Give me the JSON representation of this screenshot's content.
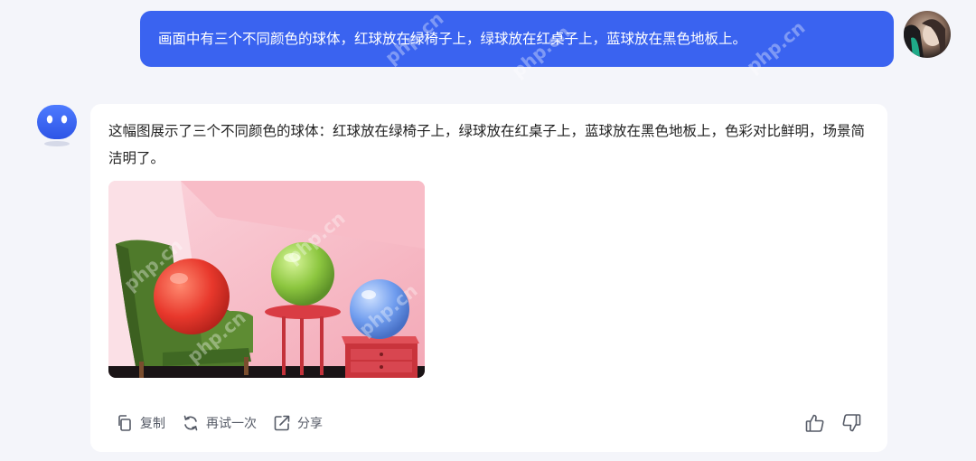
{
  "user_message": {
    "text": "画面中有三个不同颜色的球体，红球放在绿椅子上，绿球放在红桌子上，蓝球放在黑色地板上。",
    "bubble_color": "#3a63f0"
  },
  "bot_message": {
    "text": "这幅图展示了三个不同颜色的球体：红球放在绿椅子上，绿球放在红桌子上，蓝球放在黑色地板上，色彩对比鲜明，场景简洁明了。",
    "image_icon": "generated-image"
  },
  "actions": {
    "copy_label": "复制",
    "retry_label": "再试一次",
    "share_label": "分享"
  },
  "icons": {
    "copy": "copy-icon",
    "retry": "refresh-icon",
    "share": "share-icon",
    "like": "thumbs-up-icon",
    "dislike": "thumbs-down-icon"
  },
  "colors": {
    "background": "#f4f5fa",
    "accent": "#3a63f0",
    "icon": "#555a66"
  }
}
